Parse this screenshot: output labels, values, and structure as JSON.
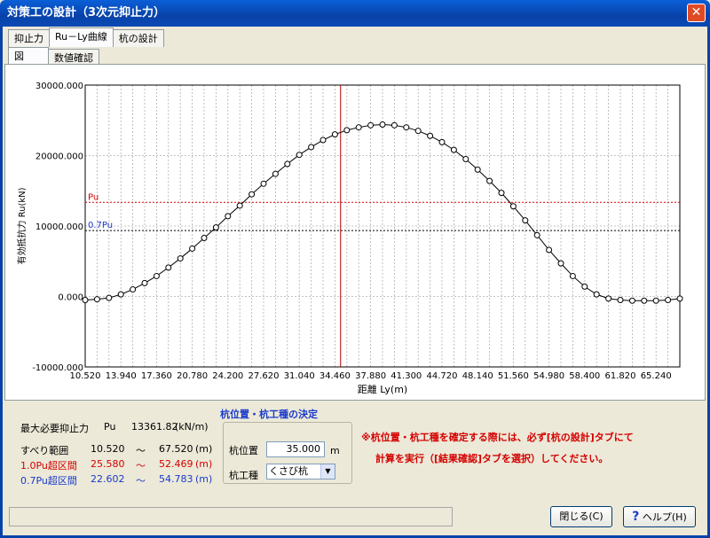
{
  "window": {
    "title": "対策工の設計（3次元抑止力）"
  },
  "tabs": [
    {
      "label": "抑止力"
    },
    {
      "label": "Ru－Ly曲線"
    },
    {
      "label": "杭の設計"
    }
  ],
  "subtabs": [
    {
      "label": "図"
    },
    {
      "label": "数値確認"
    }
  ],
  "chart_data": {
    "type": "line",
    "xlabel": "距離 Ly(m)",
    "ylabel": "有効抵抗力 Ru(kN)",
    "xlim": [
      10.52,
      67.52
    ],
    "ylim": [
      -10000,
      30000
    ],
    "x_tick_labels": [
      "10.520",
      "13.940",
      "17.360",
      "20.780",
      "24.200",
      "27.620",
      "31.040",
      "34.460",
      "37.880",
      "41.300",
      "44.720",
      "48.140",
      "51.560",
      "54.980",
      "58.400",
      "61.820",
      "65.240"
    ],
    "y_tick_labels": [
      "30000.000",
      "20000.000",
      "10000.000",
      "0.000",
      "-10000.000"
    ],
    "reference_lines": [
      {
        "name": "Pu",
        "value": 13361.82,
        "color": "#d40000"
      },
      {
        "name": "0.7Pu",
        "value": 9353.27,
        "color": "#1a3acc"
      }
    ],
    "vertical_marker": {
      "x": 35.0,
      "color": "#b00000"
    },
    "series": [
      {
        "x": [
          10.52,
          11.66,
          12.8,
          13.94,
          15.08,
          16.22,
          17.36,
          18.5,
          19.64,
          20.78,
          21.92,
          23.06,
          24.2,
          25.34,
          26.48,
          27.62,
          28.76,
          29.9,
          31.04,
          32.18,
          33.32,
          34.46,
          35.6,
          36.74,
          37.88,
          39.02,
          40.16,
          41.3,
          42.44,
          43.58,
          44.72,
          45.86,
          47.0,
          48.14,
          49.28,
          50.42,
          51.56,
          52.7,
          53.84,
          54.98,
          56.12,
          57.26,
          58.4,
          59.54,
          60.68,
          61.82,
          62.96,
          64.1,
          65.24,
          66.38,
          67.52
        ],
        "values": [
          -500,
          -400,
          -200,
          300,
          1000,
          1900,
          2900,
          4100,
          5400,
          6800,
          8300,
          9800,
          11400,
          12900,
          14500,
          16000,
          17400,
          18800,
          20100,
          21200,
          22200,
          23000,
          23600,
          24000,
          24300,
          24400,
          24300,
          24000,
          23500,
          22800,
          21900,
          20800,
          19500,
          18000,
          16400,
          14700,
          12800,
          10800,
          8700,
          6600,
          4700,
          2900,
          1400,
          300,
          -300,
          -500,
          -600,
          -600,
          -600,
          -500,
          -300
        ]
      }
    ],
    "grid": true
  },
  "summary": {
    "max_required_label": "最大必要抑止力",
    "pu_symbol": "Pu",
    "max_required_value": "13361.82",
    "max_required_unit": "(kN/m)",
    "slip_range_label": "すべり範囲",
    "slip_range_from": "10.520",
    "slip_range_to": "67.520",
    "pu10_label": "1.0Pu超区間",
    "pu10_from": "25.580",
    "pu10_to": "52.469",
    "pu07_label": "0.7Pu超区間",
    "pu07_from": "22.602",
    "pu07_to": "54.783",
    "tilde": "～",
    "unit_m": "(m)"
  },
  "pile_group": {
    "title": "杭位置・杭工種の決定",
    "position_label": "杭位置",
    "position_value": "35.000",
    "position_unit": "m",
    "type_label": "杭工種",
    "type_value": "くさび杭"
  },
  "notice": {
    "line1": "※杭位置・杭工種を確定する際には、必ず[杭の設計]タブにて",
    "line2": "計算を実行（[結果確認]タブを選択）してください。"
  },
  "buttons": {
    "close": "閉じる(C)",
    "help": "ヘルプ(H)"
  },
  "colors": {
    "titlebar": "#0842a8",
    "notice": "#d40000",
    "group_title": "#1a3acc"
  }
}
